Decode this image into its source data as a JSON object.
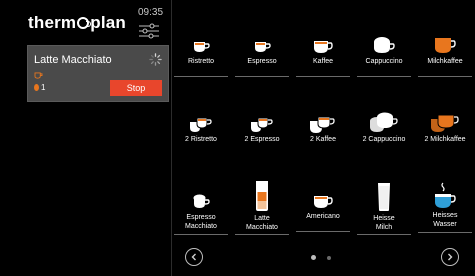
{
  "brand": {
    "name_prefix": "therm",
    "name_suffix": "plan"
  },
  "clock": "09:35",
  "order": {
    "title": "Latte Macchiato",
    "quantity": "1",
    "stop_label": "Stop"
  },
  "drinks": [
    {
      "label": "Ristretto",
      "icon": "cup-espresso-icon"
    },
    {
      "label": "Espresso",
      "icon": "cup-espresso-icon"
    },
    {
      "label": "Kaffee",
      "icon": "cup-coffee-icon"
    },
    {
      "label": "Cappuccino",
      "icon": "cup-cappuccino-icon"
    },
    {
      "label": "Milchkaffee",
      "icon": "cup-milchkaffee-icon"
    },
    {
      "label": "2 Ristretto",
      "icon": "double-cup-icon"
    },
    {
      "label": "2 Espresso",
      "icon": "double-cup-icon"
    },
    {
      "label": "2 Kaffee",
      "icon": "double-cup-icon"
    },
    {
      "label": "2 Cappuccino",
      "icon": "double-cappuccino-icon"
    },
    {
      "label": "2 Milchkaffee",
      "icon": "double-milchkaffee-icon"
    },
    {
      "label_line1": "Espresso",
      "label_line2": "Macchiato",
      "icon": "cup-macchiato-icon"
    },
    {
      "label_line1": "Latte",
      "label_line2": "Macchiato",
      "icon": "glass-latte-icon"
    },
    {
      "label": "Americano",
      "icon": "cup-coffee-icon"
    },
    {
      "label_line1": "Heisse",
      "label_line2": "Milch",
      "icon": "glass-milk-icon"
    },
    {
      "label_line1": "Heisses",
      "label_line2": "Wasser",
      "icon": "cup-water-icon"
    }
  ],
  "pager": {
    "pages": 2,
    "current": 1
  },
  "colors": {
    "accent_orange": "#e8761e",
    "stop_red": "#e8462c",
    "water_blue": "#2f9fd8",
    "panel": "#4a4a4a"
  }
}
